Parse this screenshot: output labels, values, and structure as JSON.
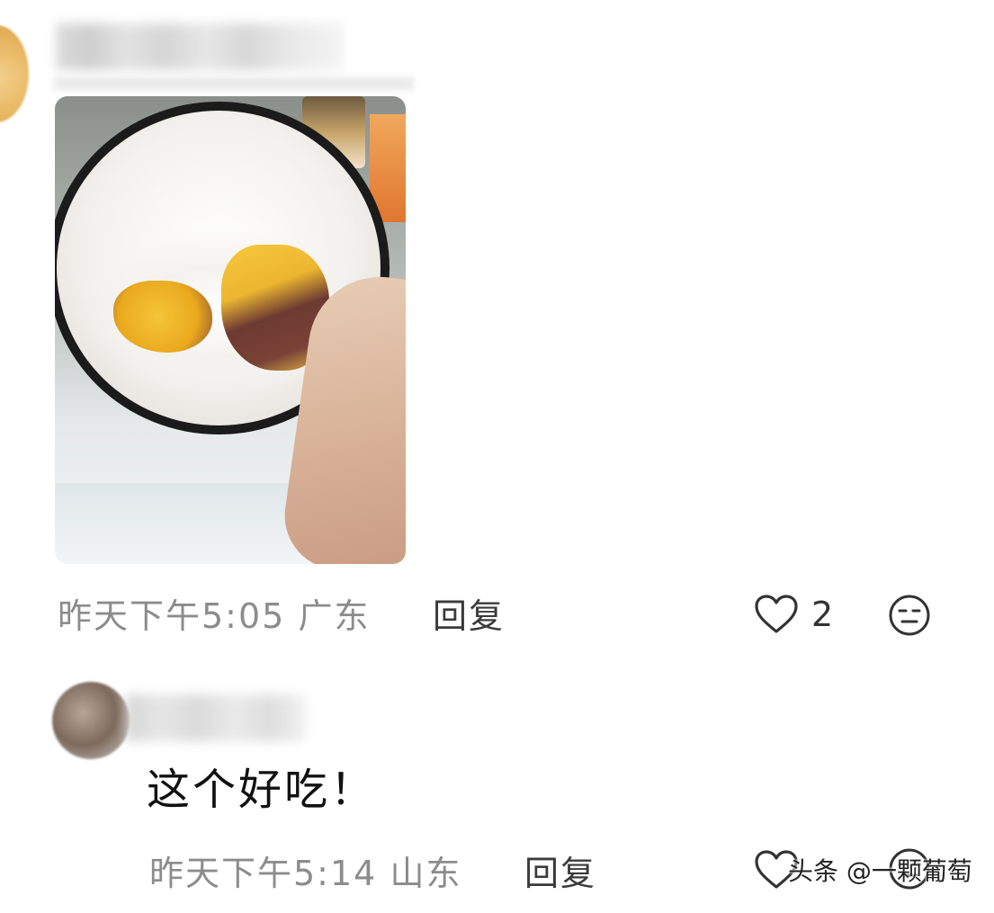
{
  "comments": [
    {
      "time": "昨天下午5:05",
      "location": "广东",
      "reply_label": "回复",
      "like_count": "2"
    },
    {
      "text": "这个好吃！",
      "time": "昨天下午5:14",
      "location": "山东",
      "reply_label": "回复"
    }
  ],
  "watermark": "头条 @一颗葡萄",
  "icons": {
    "like": "heart-outline-icon",
    "emoji": "neutral-face-icon"
  },
  "colors": {
    "meta_text": "#8c8c8c",
    "reply_text": "#3a3a3a",
    "icon": "#333333"
  }
}
